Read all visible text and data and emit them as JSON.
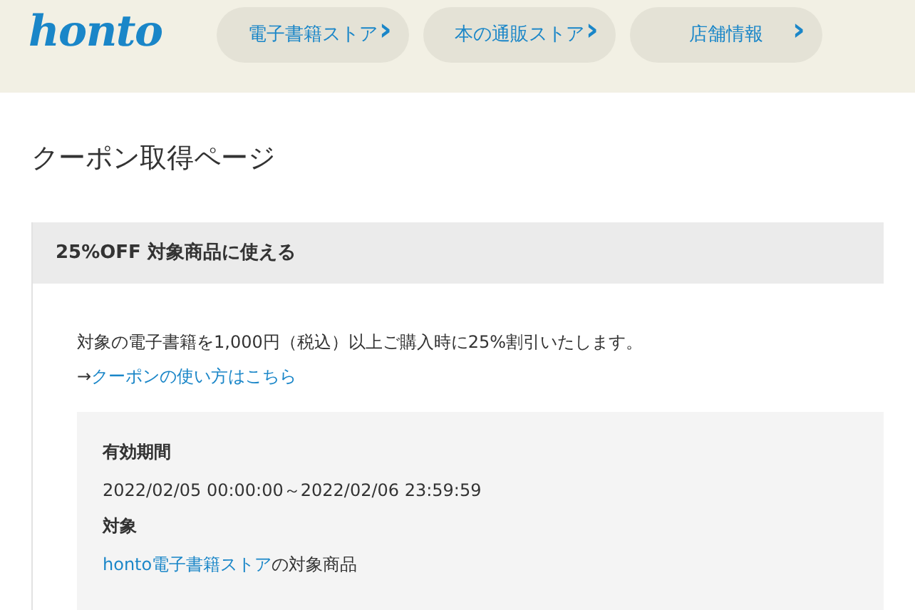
{
  "header": {
    "logo": "honto",
    "nav": [
      {
        "label": "電子書籍ストア",
        "arrow": "›"
      },
      {
        "label": "本の通販ストア",
        "arrow": "›"
      },
      {
        "label": "店舗情報",
        "arrow": "›"
      }
    ]
  },
  "page_title": "クーポン取得ページ",
  "coupon": {
    "title": "25%OFF 対象商品に使える",
    "description": "対象の電子書籍を1,000円（税込）以上ご購入時に25%割引いたします。",
    "howto": {
      "prefix": "→",
      "link": "クーポンの使い方はこちら"
    },
    "details": [
      {
        "label": "有効期間",
        "value": {
          "text": "2022/02/05 00:00:00～2022/02/06 23:59:59"
        }
      },
      {
        "label": "対象",
        "value": {
          "link": "honto電子書籍ストア",
          "text": "の対象商品"
        }
      }
    ]
  }
}
